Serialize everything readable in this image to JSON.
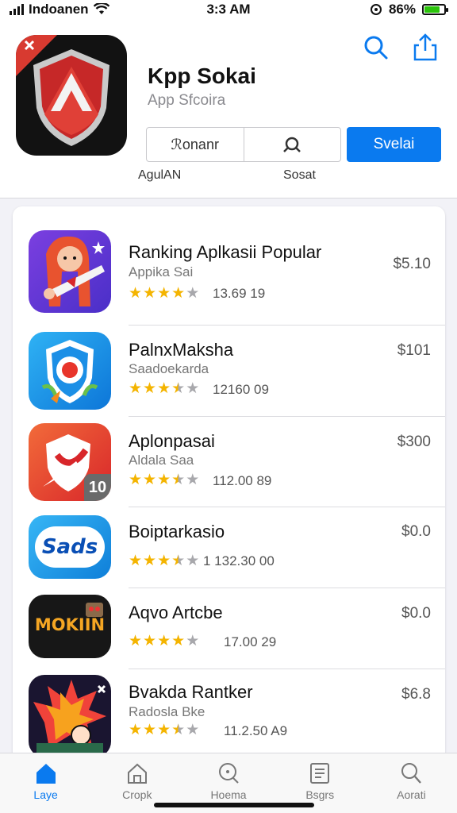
{
  "status": {
    "carrier": "Indoanen",
    "time": "3:3 AM",
    "battery_pct": "86%"
  },
  "header": {
    "app_title": "Kpp Sokai",
    "app_subtitle": "App Sfcoira",
    "seg_left": "ℛonanr",
    "primary_button": "Svelai",
    "label_left": "AgulAN",
    "label_right": "Sosat"
  },
  "apps": [
    {
      "name": "Ranking Aplkasii Popular",
      "sub": "Appika Sai",
      "count": "13.69 19",
      "price": "$5.10",
      "rating": 4
    },
    {
      "name": "PalnxMaksha",
      "sub": "Saadoekarda",
      "count": "12160 09",
      "price": "$101",
      "rating": 3.5
    },
    {
      "name": "Aplonpasai",
      "sub": "Aldala Saa",
      "count": "112.00 89",
      "price": "$300",
      "rating": 3.5,
      "badge": "10"
    },
    {
      "name": "Boiptarkasio",
      "sub": "",
      "count": "1  132.30 00",
      "price": "$0.0",
      "rating": 3.5,
      "icon_text": "Sads"
    },
    {
      "name": "Aqvo Artcbe",
      "sub": "",
      "count": "17.00 29",
      "price": "$0.0",
      "rating": 4,
      "icon_text": "MOKIIN"
    },
    {
      "name": "Bvakda Rantker",
      "sub": "Radosla Bke",
      "count": "11.2.50 A9",
      "price": "$6.8",
      "rating": 3.5
    }
  ],
  "tabs": [
    {
      "label": "Laye",
      "icon": "home-icon"
    },
    {
      "label": "Cropk",
      "icon": "house-outline-icon"
    },
    {
      "label": "Hoema",
      "icon": "magnifier-dot-icon"
    },
    {
      "label": "Bsgrs",
      "icon": "list-doc-icon"
    },
    {
      "label": "Aorati",
      "icon": "search-icon"
    }
  ],
  "colors": {
    "accent": "#0a7aef",
    "star": "#f4b400",
    "brand_red": "#d83a30"
  }
}
